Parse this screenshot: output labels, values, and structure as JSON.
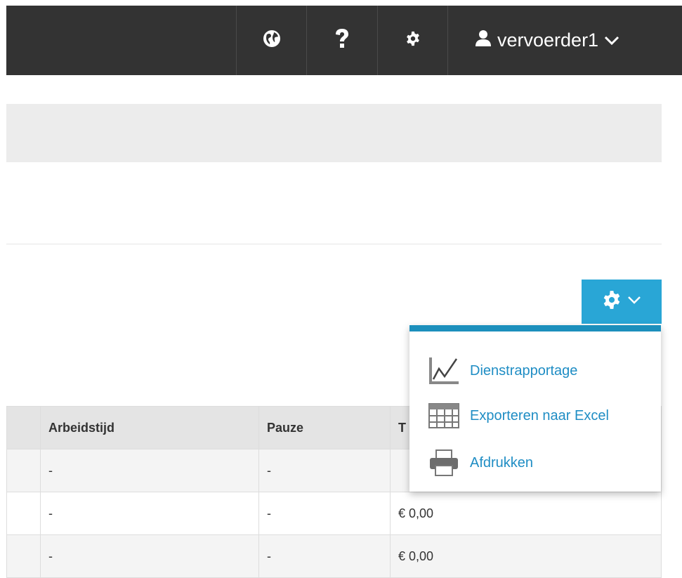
{
  "topbar": {
    "user_name": "vervoerder1",
    "icons": [
      "globe-icon",
      "help-icon",
      "gear-icon",
      "user-icon",
      "chevron-down-icon"
    ]
  },
  "colors": {
    "topbar": "#333333",
    "accent": "#29a6d6",
    "link": "#1f8dc4"
  },
  "settings_menu": {
    "items": [
      {
        "label": "Dienstrapportage",
        "icon": "line-chart-icon"
      },
      {
        "label": "Exporteren naar Excel",
        "icon": "table-icon"
      },
      {
        "label": "Afdrukken",
        "icon": "printer-icon"
      }
    ]
  },
  "table": {
    "headers": [
      "",
      "Arbeidstijd",
      "Pauze",
      "T"
    ],
    "rows": [
      [
        "",
        "-",
        "-",
        ""
      ],
      [
        "",
        "-",
        "-",
        "€ 0,00"
      ],
      [
        "",
        "-",
        "-",
        "€ 0,00"
      ]
    ]
  }
}
